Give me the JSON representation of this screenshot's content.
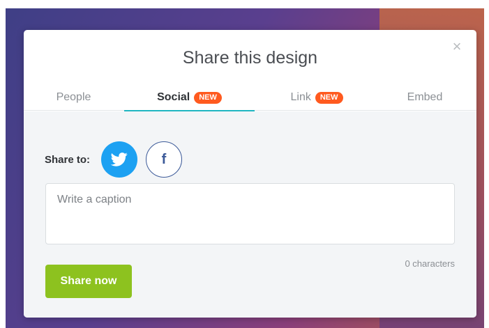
{
  "modal": {
    "title": "Share this design",
    "close_icon": "close-icon"
  },
  "tabs": [
    {
      "label": "People",
      "active": false,
      "badge": ""
    },
    {
      "label": "Social",
      "active": true,
      "badge": "NEW"
    },
    {
      "label": "Link",
      "active": false,
      "badge": "NEW"
    },
    {
      "label": "Embed",
      "active": false,
      "badge": ""
    }
  ],
  "share": {
    "label": "Share to:",
    "networks": [
      {
        "name": "twitter",
        "icon": "twitter-icon",
        "color": "#1da1f2",
        "selected": true
      },
      {
        "name": "facebook",
        "icon": "facebook-icon",
        "color": "#3b5998",
        "selected": false
      }
    ]
  },
  "caption": {
    "placeholder": "Write a caption",
    "value": ""
  },
  "char_count": "0 characters",
  "share_button": "Share now",
  "colors": {
    "accent_tab": "#1fb6c1",
    "badge": "#ff5a1f",
    "share_button": "#8dc21f"
  }
}
